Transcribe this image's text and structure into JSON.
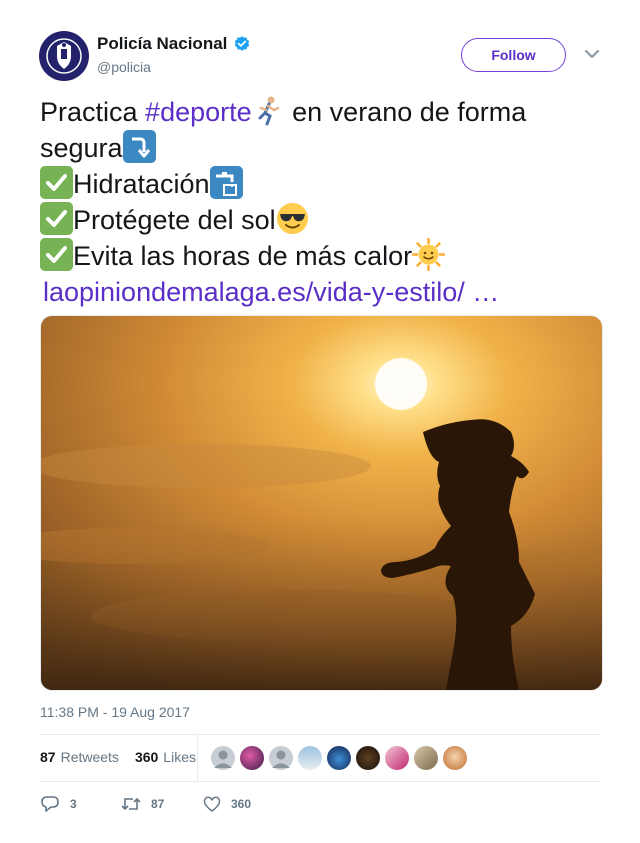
{
  "user": {
    "display_name": "Policía Nacional",
    "handle": "@policia",
    "avatar_icon": "police-badge-icon",
    "verified_icon": "verified-badge-icon"
  },
  "follow_label": "Follow",
  "tweet": {
    "line1_prefix": "Practica ",
    "hashtag": "#deporte",
    "line1_suffix": " en verano de forma",
    "line2": "segura",
    "item1": "Hidratación",
    "item2": "Protégete del sol",
    "item3": "Evita las horas de más calor",
    "link": "laopiniondemalaga.es/vida-y-estilo/   …"
  },
  "emojis": {
    "runner": "running-person-icon",
    "arrow": "right-arrow-curving-down-icon",
    "check": "check-mark-button-icon",
    "tap": "potable-water-icon",
    "sunglasses": "smiling-face-with-sunglasses-icon",
    "sun": "sun-with-face-icon"
  },
  "media": {
    "image_icon": "woman-running-at-sunset-photo"
  },
  "timestamp": "11:38 PM - 19 Aug 2017",
  "stats": {
    "retweets_count": "87",
    "retweets_label": "Retweets",
    "likes_count": "360",
    "likes_label": "Likes"
  },
  "actions": {
    "reply_count": "3",
    "retweet_count": "87",
    "like_count": "360"
  },
  "colors": {
    "accent": "#5b2fc7",
    "muted": "#657786",
    "verified": "#1da1f2"
  }
}
